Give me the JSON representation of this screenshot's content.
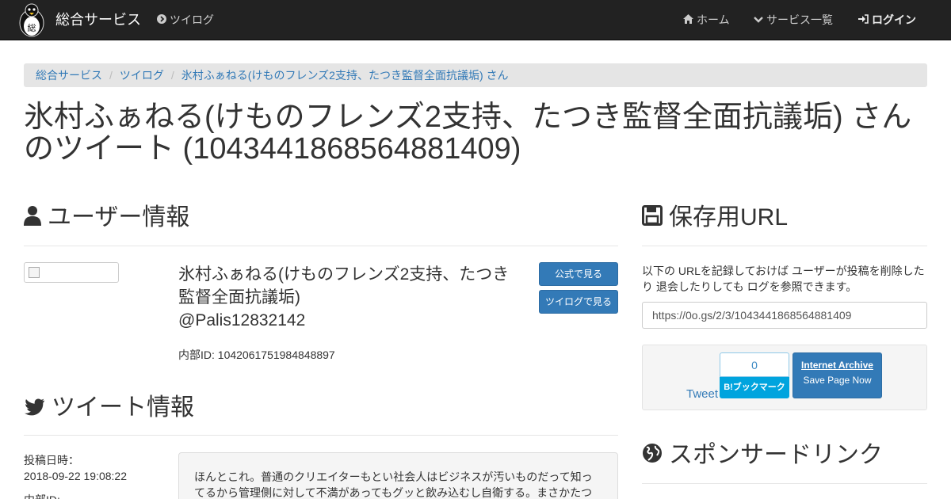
{
  "navbar": {
    "brand": "総合サービス",
    "twilog": "ツイログ",
    "home": "ホーム",
    "services": "サービス一覧",
    "login": "ログイン"
  },
  "breadcrumb": [
    "総合サービス",
    "ツイログ",
    "氷村ふぁねる(けものフレンズ2支持、たつき監督全面抗議垢) さん"
  ],
  "page_title": "氷村ふぁねる(けものフレンズ2支持、たつき監督全面抗議垢) さんのツイート (1043441868564881409)",
  "user_section": {
    "heading": "ユーザー情報",
    "name": "氷村ふぁねる(けものフレンズ2支持、たつき監督全面抗議垢)",
    "handle": "@Palis12832142",
    "internal_id": "内部ID: 1042061751984848897",
    "btn_official": "公式で見る",
    "btn_twilog": "ツイログで見る"
  },
  "tweet_section": {
    "heading": "ツイート情報",
    "posted_label": "投稿日時：",
    "posted_value": "2018-09-22 19:08:22",
    "id_label": "内部ID:",
    "text": "ほんとこれ。普通のクリエイターもとい社会人はビジネスが汚いものだって知ってるから管理側に対して不満があってもグッと飲み込むし自衛する。まさかたつ"
  },
  "save_section": {
    "heading": "保存用URL",
    "desc": "以下の URLを記録しておけば ユーザーが投稿を削除したり 退会したりしても ログを参照できます。",
    "url": "https://0o.gs/2/3/1043441868564881409",
    "tweet": "Tweet",
    "hatena_count": "0",
    "hatena_label": "B!ブックマーク",
    "ia_title": "Internet Archive",
    "ia_sub": "Save Page Now"
  },
  "sponsor_section": {
    "heading": "スポンサードリンク"
  }
}
